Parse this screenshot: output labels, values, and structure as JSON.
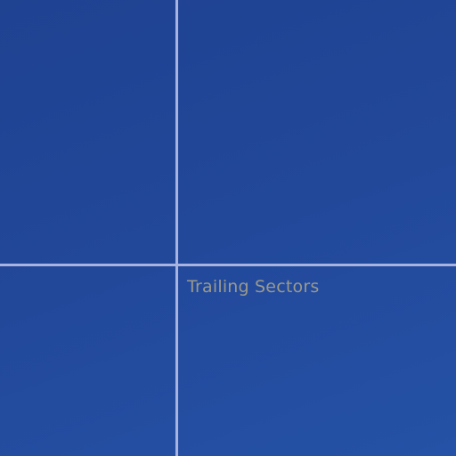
{
  "quadrants": {
    "bottom_right": {
      "label": "Trailing Sectors"
    }
  },
  "colors": {
    "background": "#22489a",
    "axis_lines": "#a9b3e0",
    "label_text": "#9a9a8c"
  }
}
